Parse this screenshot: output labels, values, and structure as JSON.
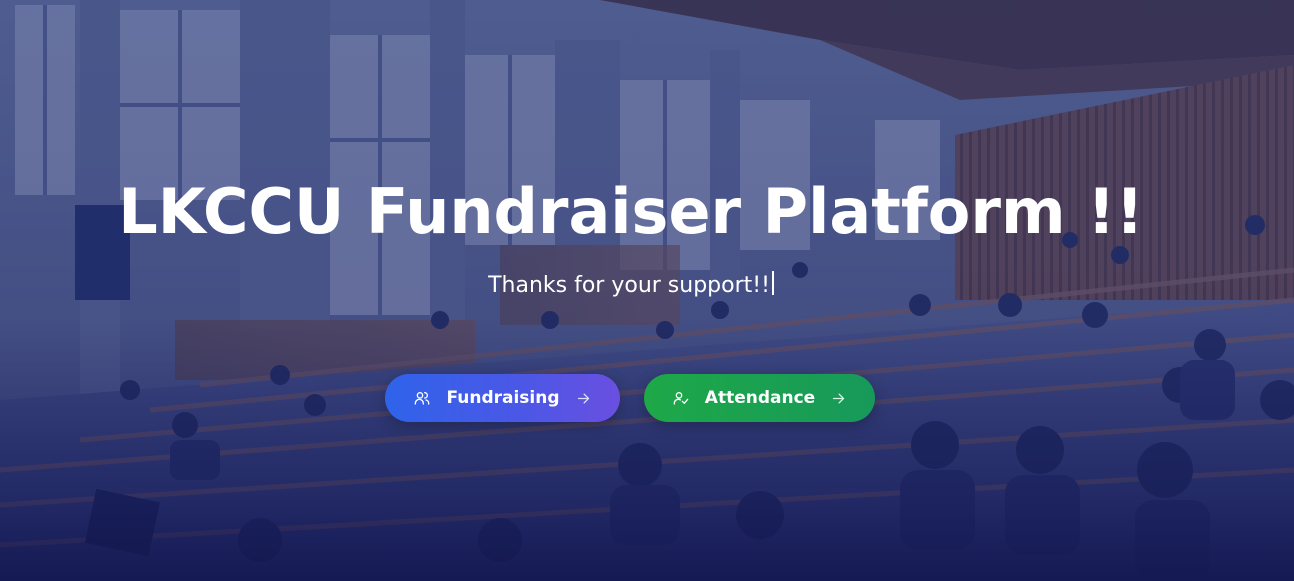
{
  "hero": {
    "title": "LKCCU Fundraiser Platform !!",
    "subtitle": "Thanks for your support!!",
    "background_icon": "lecture-hall-photo"
  },
  "actions": {
    "fundraising": {
      "label": "Fundraising",
      "icon": "users-icon",
      "trailing_icon": "arrow-right-icon",
      "color_start": "#2f63ea",
      "color_end": "#6a4fe0"
    },
    "attendance": {
      "label": "Attendance",
      "icon": "user-check-icon",
      "trailing_icon": "arrow-right-icon",
      "color_start": "#1ea848",
      "color_end": "#17995a"
    }
  }
}
